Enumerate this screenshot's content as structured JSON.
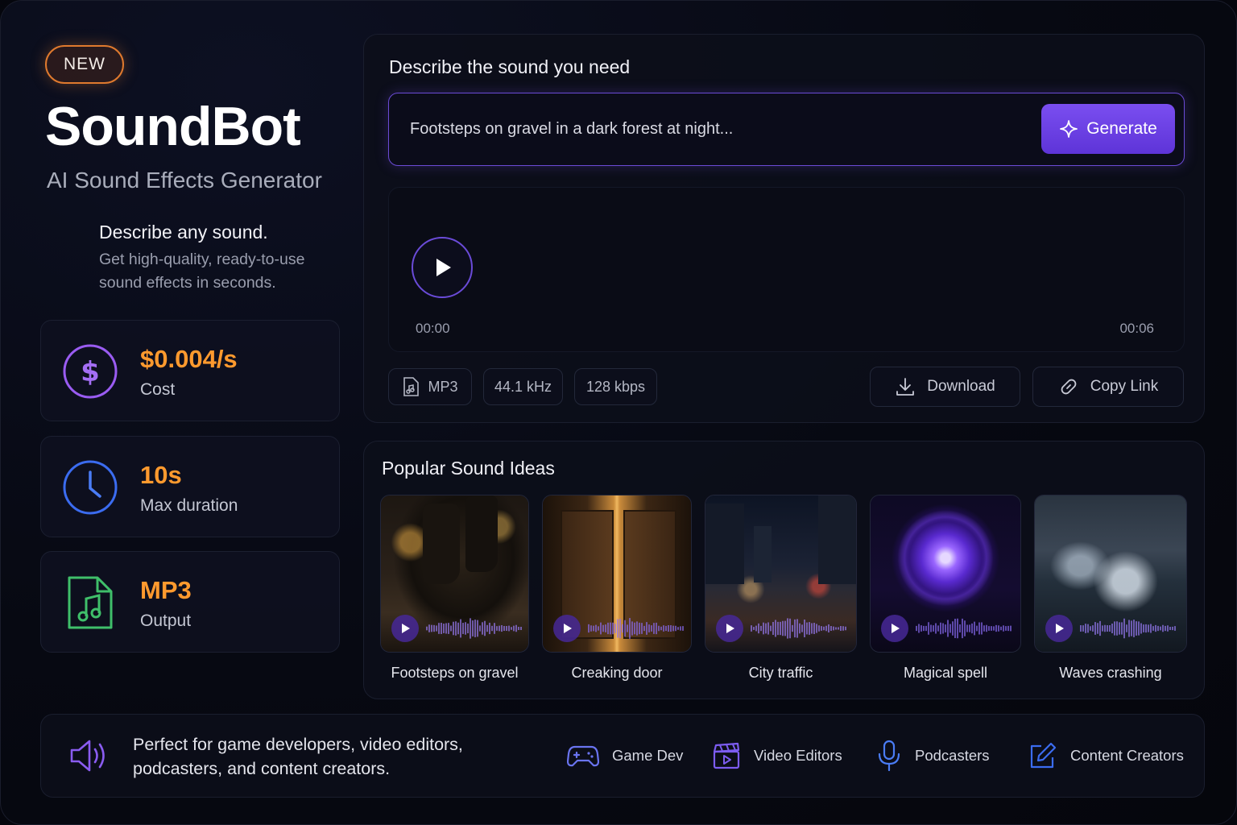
{
  "badge": "NEW",
  "brand": {
    "name": "SoundBot",
    "subtitle": "AI Sound Effects Generator"
  },
  "intro": {
    "title": "Describe any sound.",
    "text": "Get high-quality, ready-to-use sound effects in seconds."
  },
  "stats": [
    {
      "value": "$0.004/s",
      "label": "Cost",
      "icon": "dollar-icon"
    },
    {
      "value": "10s",
      "label": "Max duration",
      "icon": "clock-icon"
    },
    {
      "value": "MP3",
      "label": "Output",
      "icon": "music-file-icon"
    }
  ],
  "generator": {
    "title": "Describe the sound you need",
    "prompt_value": "Footsteps on gravel in a dark forest at night...",
    "generate_label": "Generate"
  },
  "player": {
    "time_start": "00:00",
    "time_end": "00:06"
  },
  "format": {
    "type": "MP3",
    "sample_rate": "44.1 kHz",
    "bitrate": "128 kbps"
  },
  "actions": {
    "download": "Download",
    "copy_link": "Copy Link"
  },
  "ideas": {
    "title": "Popular Sound Ideas",
    "items": [
      {
        "label": "Footsteps on gravel"
      },
      {
        "label": "Creaking door"
      },
      {
        "label": "City traffic"
      },
      {
        "label": "Magical spell"
      },
      {
        "label": "Waves crashing"
      }
    ]
  },
  "audience": {
    "text": "Perfect for game developers, video editors, podcasters, and content creators.",
    "items": [
      {
        "label": "Game Dev",
        "icon": "gamepad-icon"
      },
      {
        "label": "Video Editors",
        "icon": "clapperboard-icon"
      },
      {
        "label": "Podcasters",
        "icon": "microphone-icon"
      },
      {
        "label": "Content Creators",
        "icon": "edit-icon"
      }
    ]
  },
  "colors": {
    "accent": "#7a4ef0",
    "orange": "#ff9a2e",
    "blue": "#3b6cf0",
    "green": "#3fbf6a"
  }
}
